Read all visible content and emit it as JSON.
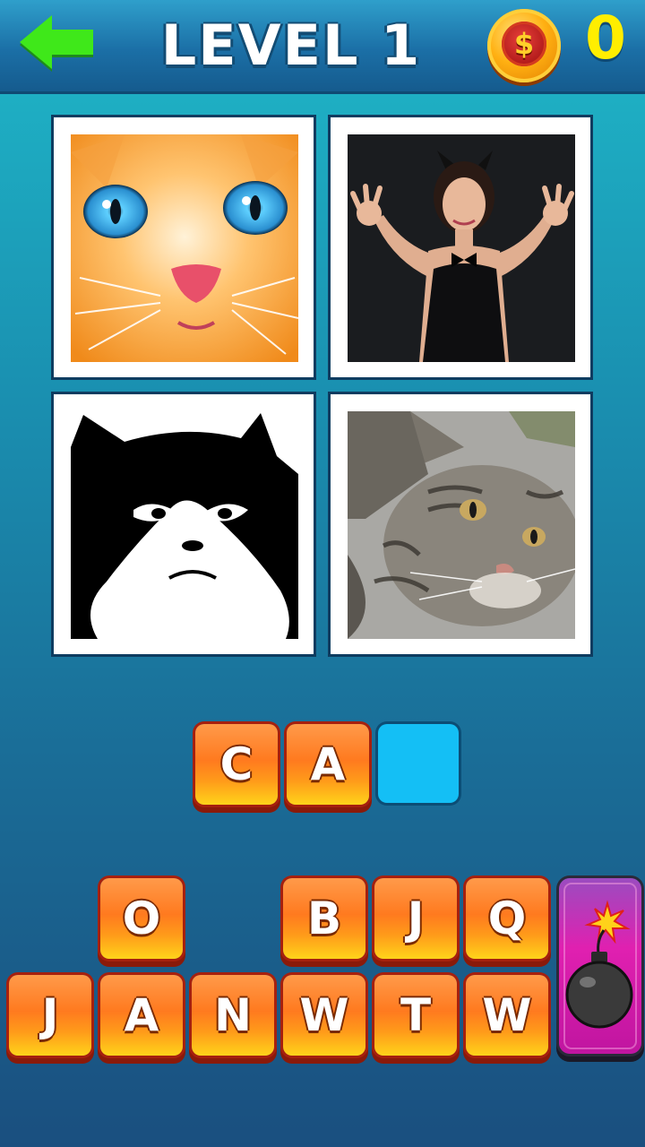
{
  "header": {
    "title": "LEVEL 1",
    "coin_symbol": "$",
    "coins": "0"
  },
  "photos": [
    {
      "icon": "kitten-face-photo"
    },
    {
      "icon": "cat-costume-girl-photo"
    },
    {
      "icon": "cat-silhouette-photo"
    },
    {
      "icon": "tabby-cat-photo"
    }
  ],
  "answer": {
    "letters": [
      "C",
      "A",
      ""
    ]
  },
  "letter_bank": {
    "row1": [
      "O",
      "",
      "B",
      "J",
      "Q"
    ],
    "row2": [
      "J",
      "A",
      "N",
      "W",
      "T",
      "W"
    ]
  },
  "colors": {
    "tile_orange": "#ff7a1f",
    "empty_slot": "#14bff5",
    "coin_text": "#ffee00",
    "bomb_bg": "#e020b0"
  }
}
